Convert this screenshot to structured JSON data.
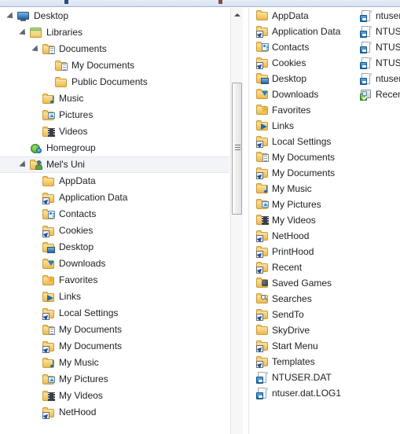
{
  "window": {
    "title_strip_color": "#dde8f6",
    "background": "#ffffff"
  },
  "tree_pane": {
    "name": "navigation-tree",
    "selected_item": "Mel's Uni",
    "items": [
      {
        "label": "Desktop",
        "indent": 0,
        "expander": "expanded",
        "icon": "monitor-icon"
      },
      {
        "label": "Libraries",
        "indent": 1,
        "expander": "expanded",
        "icon": "libraries-folder-icon"
      },
      {
        "label": "Documents",
        "indent": 2,
        "expander": "expanded",
        "icon": "documents-library-icon"
      },
      {
        "label": "My Documents",
        "indent": 3,
        "expander": "collapsed",
        "icon": "my-documents-folder-icon"
      },
      {
        "label": "Public Documents",
        "indent": 3,
        "expander": "collapsed",
        "icon": "folder-icon"
      },
      {
        "label": "Music",
        "indent": 2,
        "expander": "collapsed",
        "icon": "music-library-icon"
      },
      {
        "label": "Pictures",
        "indent": 2,
        "expander": "collapsed",
        "icon": "pictures-library-icon"
      },
      {
        "label": "Videos",
        "indent": 2,
        "expander": "collapsed",
        "icon": "videos-library-icon"
      },
      {
        "label": "Homegroup",
        "indent": 1,
        "expander": "collapsed",
        "icon": "homegroup-icon"
      },
      {
        "label": "Mel's Uni",
        "indent": 1,
        "expander": "expanded",
        "icon": "user-folder-icon",
        "selected": true
      },
      {
        "label": "AppData",
        "indent": 2,
        "expander": "collapsed",
        "icon": "folder-icon"
      },
      {
        "label": "Application Data",
        "indent": 2,
        "expander": "collapsed",
        "icon": "junction-folder-icon"
      },
      {
        "label": "Contacts",
        "indent": 2,
        "expander": "none",
        "icon": "contacts-folder-icon"
      },
      {
        "label": "Cookies",
        "indent": 2,
        "expander": "collapsed",
        "icon": "junction-folder-icon"
      },
      {
        "label": "Desktop",
        "indent": 2,
        "expander": "collapsed",
        "icon": "desktop-folder-icon"
      },
      {
        "label": "Downloads",
        "indent": 2,
        "expander": "collapsed",
        "icon": "downloads-folder-icon"
      },
      {
        "label": "Favorites",
        "indent": 2,
        "expander": "collapsed",
        "icon": "favorites-folder-icon"
      },
      {
        "label": "Links",
        "indent": 2,
        "expander": "none",
        "icon": "links-folder-icon"
      },
      {
        "label": "Local Settings",
        "indent": 2,
        "expander": "collapsed",
        "icon": "junction-folder-icon"
      },
      {
        "label": "My Documents",
        "indent": 2,
        "expander": "collapsed",
        "icon": "my-documents-folder-icon"
      },
      {
        "label": "My Documents",
        "indent": 2,
        "expander": "collapsed",
        "icon": "junction-folder-icon"
      },
      {
        "label": "My Music",
        "indent": 2,
        "expander": "collapsed",
        "icon": "my-music-folder-icon"
      },
      {
        "label": "My Pictures",
        "indent": 2,
        "expander": "collapsed",
        "icon": "my-pictures-folder-icon"
      },
      {
        "label": "My Videos",
        "indent": 2,
        "expander": "none",
        "icon": "my-videos-folder-icon"
      },
      {
        "label": "NetHood",
        "indent": 2,
        "expander": "collapsed",
        "icon": "junction-folder-icon"
      }
    ]
  },
  "scrollbar": {
    "name": "tree-vertical-scrollbar",
    "up_arrow": "scroll-up-arrow",
    "thumb_top_pct": 17,
    "thumb_height_pct": 31
  },
  "list_pane": {
    "name": "file-list",
    "column1": [
      {
        "label": "AppData",
        "icon": "folder-icon"
      },
      {
        "label": "Application Data",
        "icon": "junction-folder-icon"
      },
      {
        "label": "Contacts",
        "icon": "contacts-folder-icon"
      },
      {
        "label": "Cookies",
        "icon": "junction-folder-icon"
      },
      {
        "label": "Desktop",
        "icon": "desktop-folder-icon"
      },
      {
        "label": "Downloads",
        "icon": "downloads-folder-icon"
      },
      {
        "label": "Favorites",
        "icon": "favorites-folder-icon"
      },
      {
        "label": "Links",
        "icon": "links-folder-icon"
      },
      {
        "label": "Local Settings",
        "icon": "junction-folder-icon"
      },
      {
        "label": "My Documents",
        "icon": "my-documents-folder-icon"
      },
      {
        "label": "My Documents",
        "icon": "junction-folder-icon"
      },
      {
        "label": "My Music",
        "icon": "my-music-folder-icon"
      },
      {
        "label": "My Pictures",
        "icon": "my-pictures-folder-icon"
      },
      {
        "label": "My Videos",
        "icon": "my-videos-folder-icon"
      },
      {
        "label": "NetHood",
        "icon": "junction-folder-icon"
      },
      {
        "label": "PrintHood",
        "icon": "junction-folder-icon"
      },
      {
        "label": "Recent",
        "icon": "junction-folder-icon"
      },
      {
        "label": "Saved Games",
        "icon": "saved-games-folder-icon"
      },
      {
        "label": "Searches",
        "icon": "searches-folder-icon"
      },
      {
        "label": "SendTo",
        "icon": "junction-folder-icon"
      },
      {
        "label": "SkyDrive",
        "icon": "folder-icon"
      },
      {
        "label": "Start Menu",
        "icon": "junction-folder-icon"
      },
      {
        "label": "Templates",
        "icon": "junction-folder-icon"
      },
      {
        "label": "NTUSER.DAT",
        "icon": "dat-file-icon"
      },
      {
        "label": "ntuser.dat.LOG1",
        "icon": "dat-log-file-icon"
      }
    ],
    "column2": [
      {
        "label": "ntuser.",
        "icon": "dat-file-icon",
        "truncated": true
      },
      {
        "label": "NTUSE",
        "icon": "dat-file-icon",
        "truncated": true
      },
      {
        "label": "NTUSE",
        "icon": "dat-file-icon",
        "truncated": true
      },
      {
        "label": "NTUSE",
        "icon": "dat-file-icon",
        "truncated": true
      },
      {
        "label": "ntuser.",
        "icon": "dat-log-file-icon",
        "truncated": true
      },
      {
        "label": "Recent",
        "icon": "recent-items-icon",
        "truncated": true
      }
    ]
  }
}
